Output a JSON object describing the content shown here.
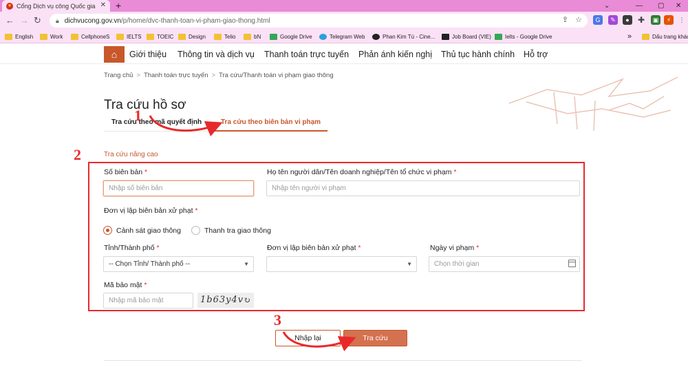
{
  "browser": {
    "tab_title": "Cổng Dịch vụ công Quốc gia",
    "tab_close": "✕",
    "new_tab": "+",
    "url_host": "dichvucong.gov.vn",
    "url_path": "/p/home/dvc-thanh-toan-vi-pham-giao-thong.html",
    "bookmarks": [
      "English",
      "Work",
      "CellphoneS",
      "IELTS",
      "TOEIC",
      "Design",
      "Telio",
      "bN",
      "Google Drive",
      "Telegram Web",
      "Phan Kim Tú - Cine...",
      "Job Board (VIE)",
      "Ielts - Google Drive"
    ],
    "bookmarks_more": "»",
    "bookmarks_other": "Dấu trang khác"
  },
  "site_nav": {
    "items": [
      "Giới thiệu",
      "Thông tin và dịch vụ",
      "Thanh toán trực tuyến",
      "Phản ánh kiến nghị",
      "Thủ tục hành chính",
      "Hỗ trợ"
    ]
  },
  "breadcrumb": [
    "Trang chủ",
    "Thanh toán trực tuyến",
    "Tra cứu/Thanh toán vi phạm giao thông"
  ],
  "breadcrumb_sep": ">",
  "page": {
    "title": "Tra cứu hồ sơ",
    "tabs": [
      "Tra cứu theo mã quyết định",
      "Tra cứu theo biên bản vi phạm"
    ],
    "active_tab": 1,
    "advanced_label": "Tra cứu nâng cao"
  },
  "form": {
    "record_no": {
      "label": "Số biên bản",
      "required": "*",
      "placeholder": "Nhập số biên bản"
    },
    "violator": {
      "label": "Họ tên người dân/Tên doanh nghiệp/Tên tổ chức vi phạm",
      "required": "*",
      "placeholder": "Nhập tên người vi phạm"
    },
    "issuer_group": {
      "label": "Đơn vị lập biên bản xử phạt",
      "required": "*"
    },
    "radios": [
      {
        "label": "Cảnh sát giao thông",
        "checked": true
      },
      {
        "label": "Thanh tra giao thông",
        "checked": false
      }
    ],
    "province": {
      "label": "Tỉnh/Thành phố",
      "required": "*",
      "value": "-- Chọn Tỉnh/ Thành phố --"
    },
    "issuer_unit": {
      "label": "Đơn vị lập biên bản xử phạt",
      "required": "*",
      "value": ""
    },
    "date": {
      "label": "Ngày vi phạm",
      "required": "*",
      "placeholder": "Chọn thời gian"
    },
    "security": {
      "label": "Mã bảo mật",
      "required": "*",
      "placeholder": "Nhập mã bảo mật",
      "captcha": "1b63y4v"
    }
  },
  "buttons": {
    "reset": "Nhập lại",
    "search": "Tra cứu"
  },
  "annotations": [
    "1",
    "2",
    "3"
  ],
  "colors": {
    "accent": "#c8572b",
    "annotation": "#e8292b",
    "browser_tab_bar": "#e98bd6",
    "browser_toolbar": "#fbe1f6"
  }
}
